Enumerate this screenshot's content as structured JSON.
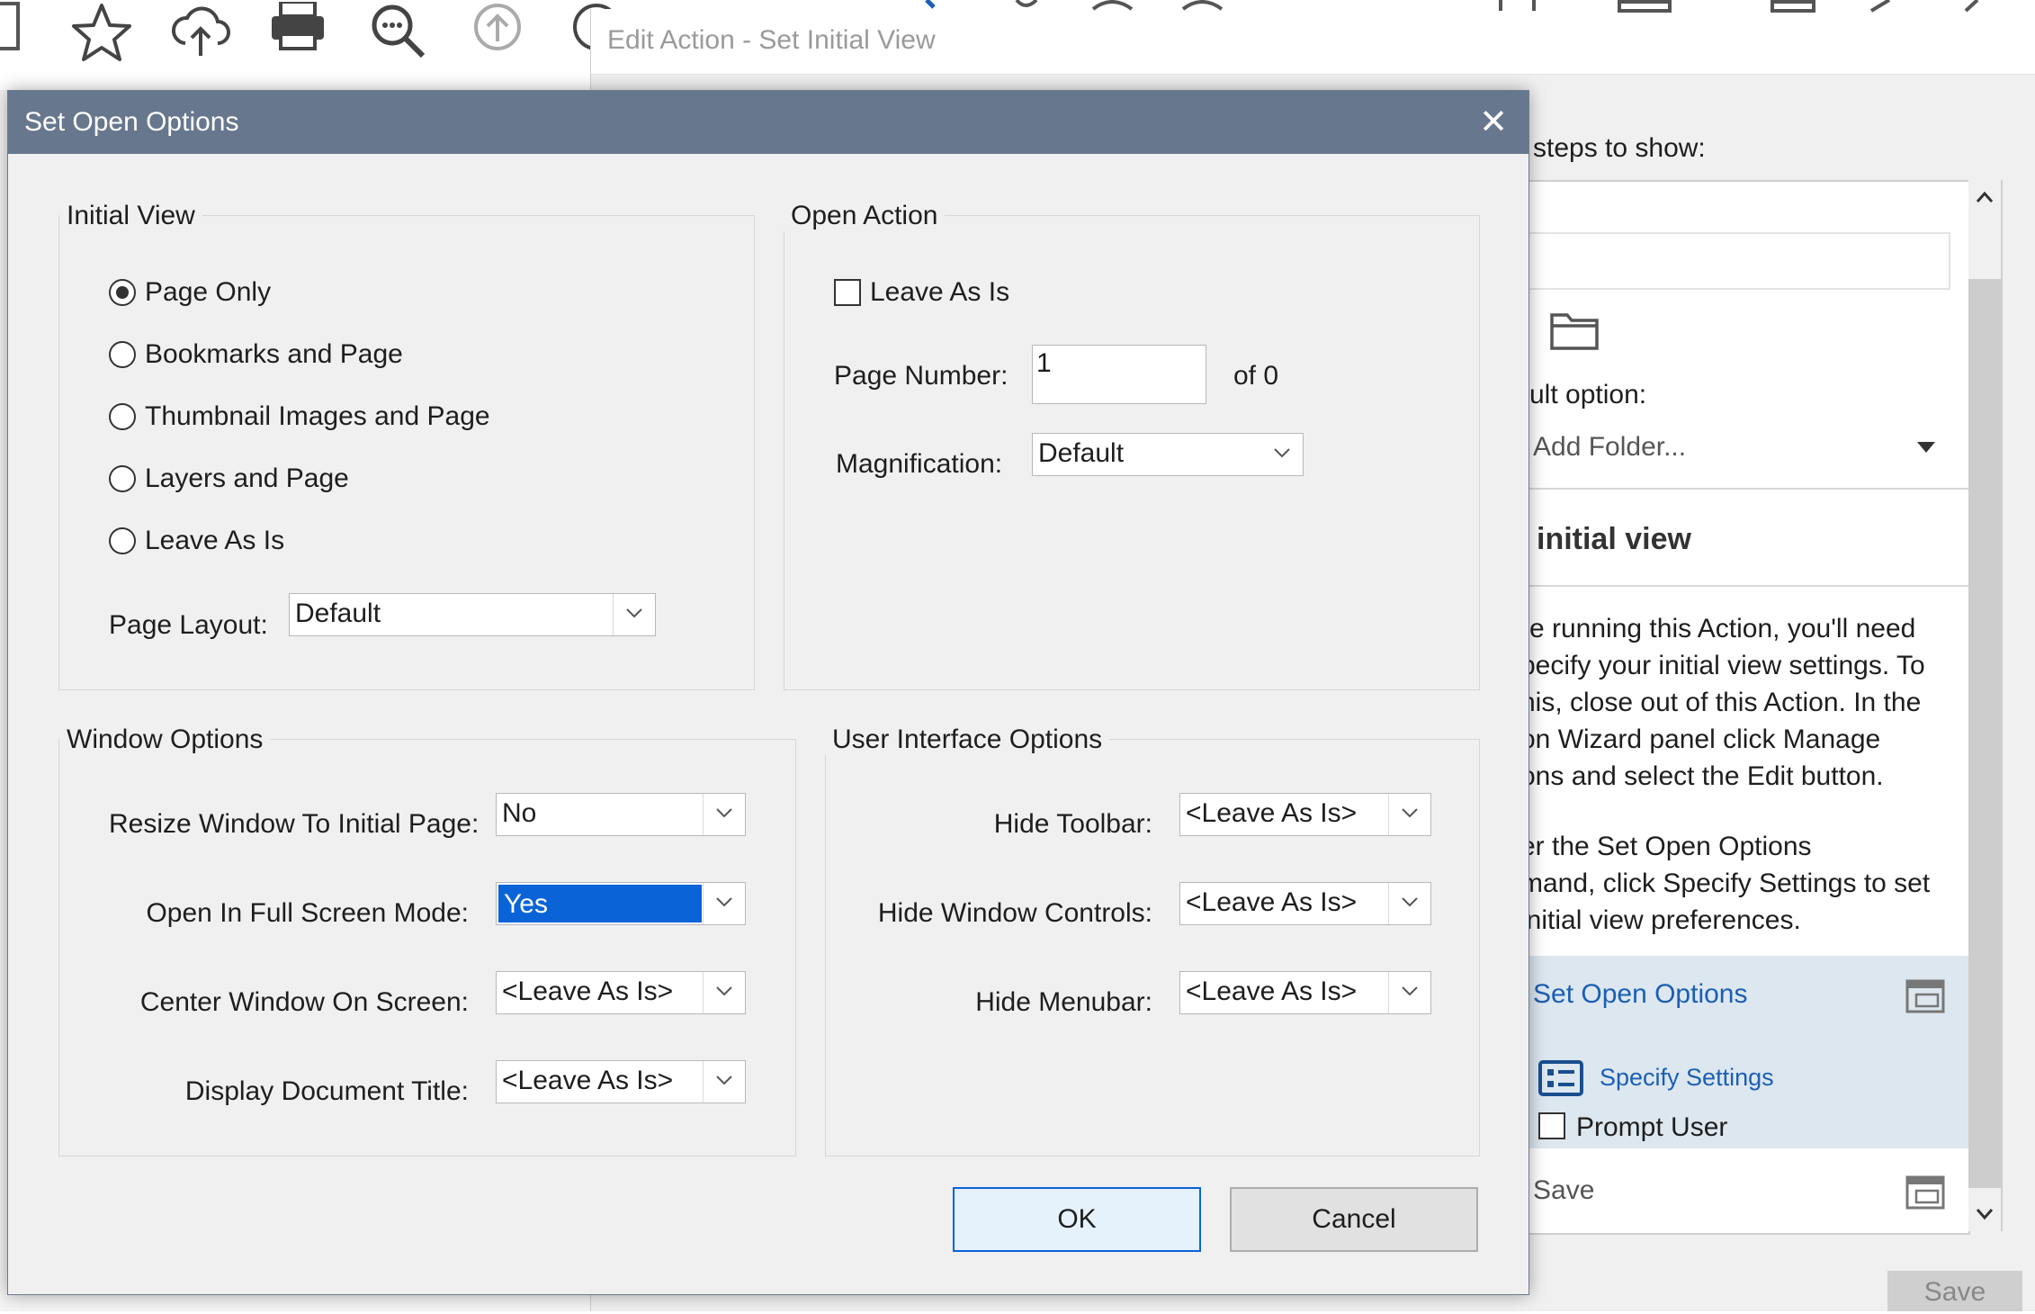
{
  "edit_action_window": {
    "title": "Edit Action - Set Initial View"
  },
  "right_panel": {
    "steps_label": "steps to show:",
    "default_option_label": "ult option:",
    "default_option_value": "Add Folder...",
    "section_heading": "initial view",
    "instructions_p1": [
      "re running this Action, you'll need",
      "pecify your initial view settings. To",
      "his, close out of this Action. In the",
      "on Wizard panel click Manage",
      "ons and select the Edit button."
    ],
    "instructions_p2": [
      "er the Set Open Options",
      "mand, click Specify Settings to set",
      " initial view preferences."
    ],
    "step_set_open_options": "Set Open Options",
    "specify_settings": "Specify Settings",
    "prompt_user": "Prompt User",
    "step_save": "Save",
    "save_button": "Save"
  },
  "dialog": {
    "title": "Set Open Options",
    "close_glyph": "✕",
    "initial_view": {
      "group_label": "Initial View",
      "options": [
        "Page Only",
        "Bookmarks and Page",
        "Thumbnail Images and Page",
        "Layers and Page",
        "Leave As Is"
      ],
      "selected_index": 0,
      "page_layout_label": "Page Layout:",
      "page_layout_value": "Default"
    },
    "open_action": {
      "group_label": "Open Action",
      "leave_as_is_label": "Leave As Is",
      "leave_as_is_checked": false,
      "page_number_label": "Page Number:",
      "page_number_value": "1",
      "of_total": "of 0",
      "magnification_label": "Magnification:",
      "magnification_value": "Default"
    },
    "window_options": {
      "group_label": "Window Options",
      "resize_label": "Resize Window To Initial Page:",
      "resize_value": "No",
      "fullscreen_label": "Open In Full Screen Mode:",
      "fullscreen_value": "Yes",
      "center_label": "Center Window On Screen:",
      "center_value": "<Leave As Is>",
      "doc_title_label": "Display Document Title:",
      "doc_title_value": "<Leave As Is>"
    },
    "ui_options": {
      "group_label": "User Interface Options",
      "hide_toolbar_label": "Hide Toolbar:",
      "hide_toolbar_value": "<Leave As Is>",
      "hide_window_controls_label": "Hide Window Controls:",
      "hide_window_controls_value": "<Leave As Is>",
      "hide_menubar_label": "Hide Menubar:",
      "hide_menubar_value": "<Leave As Is>"
    },
    "ok_label": "OK",
    "cancel_label": "Cancel"
  },
  "colors": {
    "dialog_titlebar": "#67778e",
    "selection": "#0a64d8",
    "link": "#1a5fb4",
    "step_highlight": "#dde7ef"
  }
}
